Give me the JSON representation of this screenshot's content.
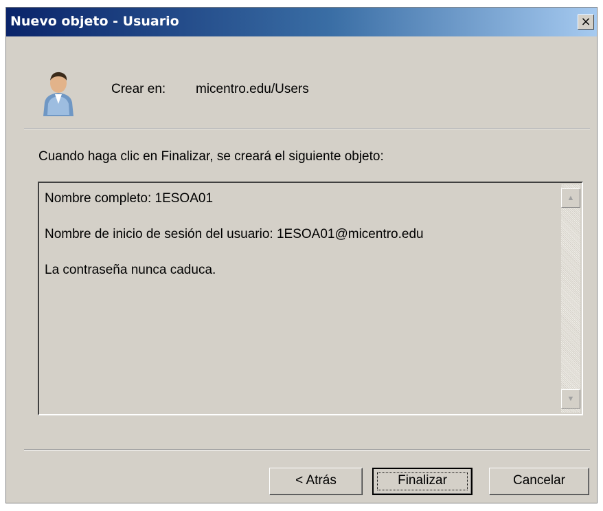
{
  "window": {
    "title": "Nuevo objeto - Usuario",
    "close_glyph": "×"
  },
  "header": {
    "icon": "user-icon",
    "create_label": "Crear en:",
    "create_path": "micentro.edu/Users"
  },
  "intro_text": "Cuando haga clic en Finalizar, se creará el siguiente objeto:",
  "summary": {
    "lines": [
      "Nombre completo: 1ESOA01",
      "Nombre de inicio de sesión del usuario: 1ESOA01@micentro.edu",
      "La contraseña nunca caduca."
    ]
  },
  "buttons": {
    "back": "< Atrás",
    "finish": "Finalizar",
    "cancel": "Cancelar"
  },
  "colors": {
    "dialog_bg": "#d4d0c8",
    "titlebar_start": "#0a246a",
    "titlebar_end": "#a6caf0"
  }
}
